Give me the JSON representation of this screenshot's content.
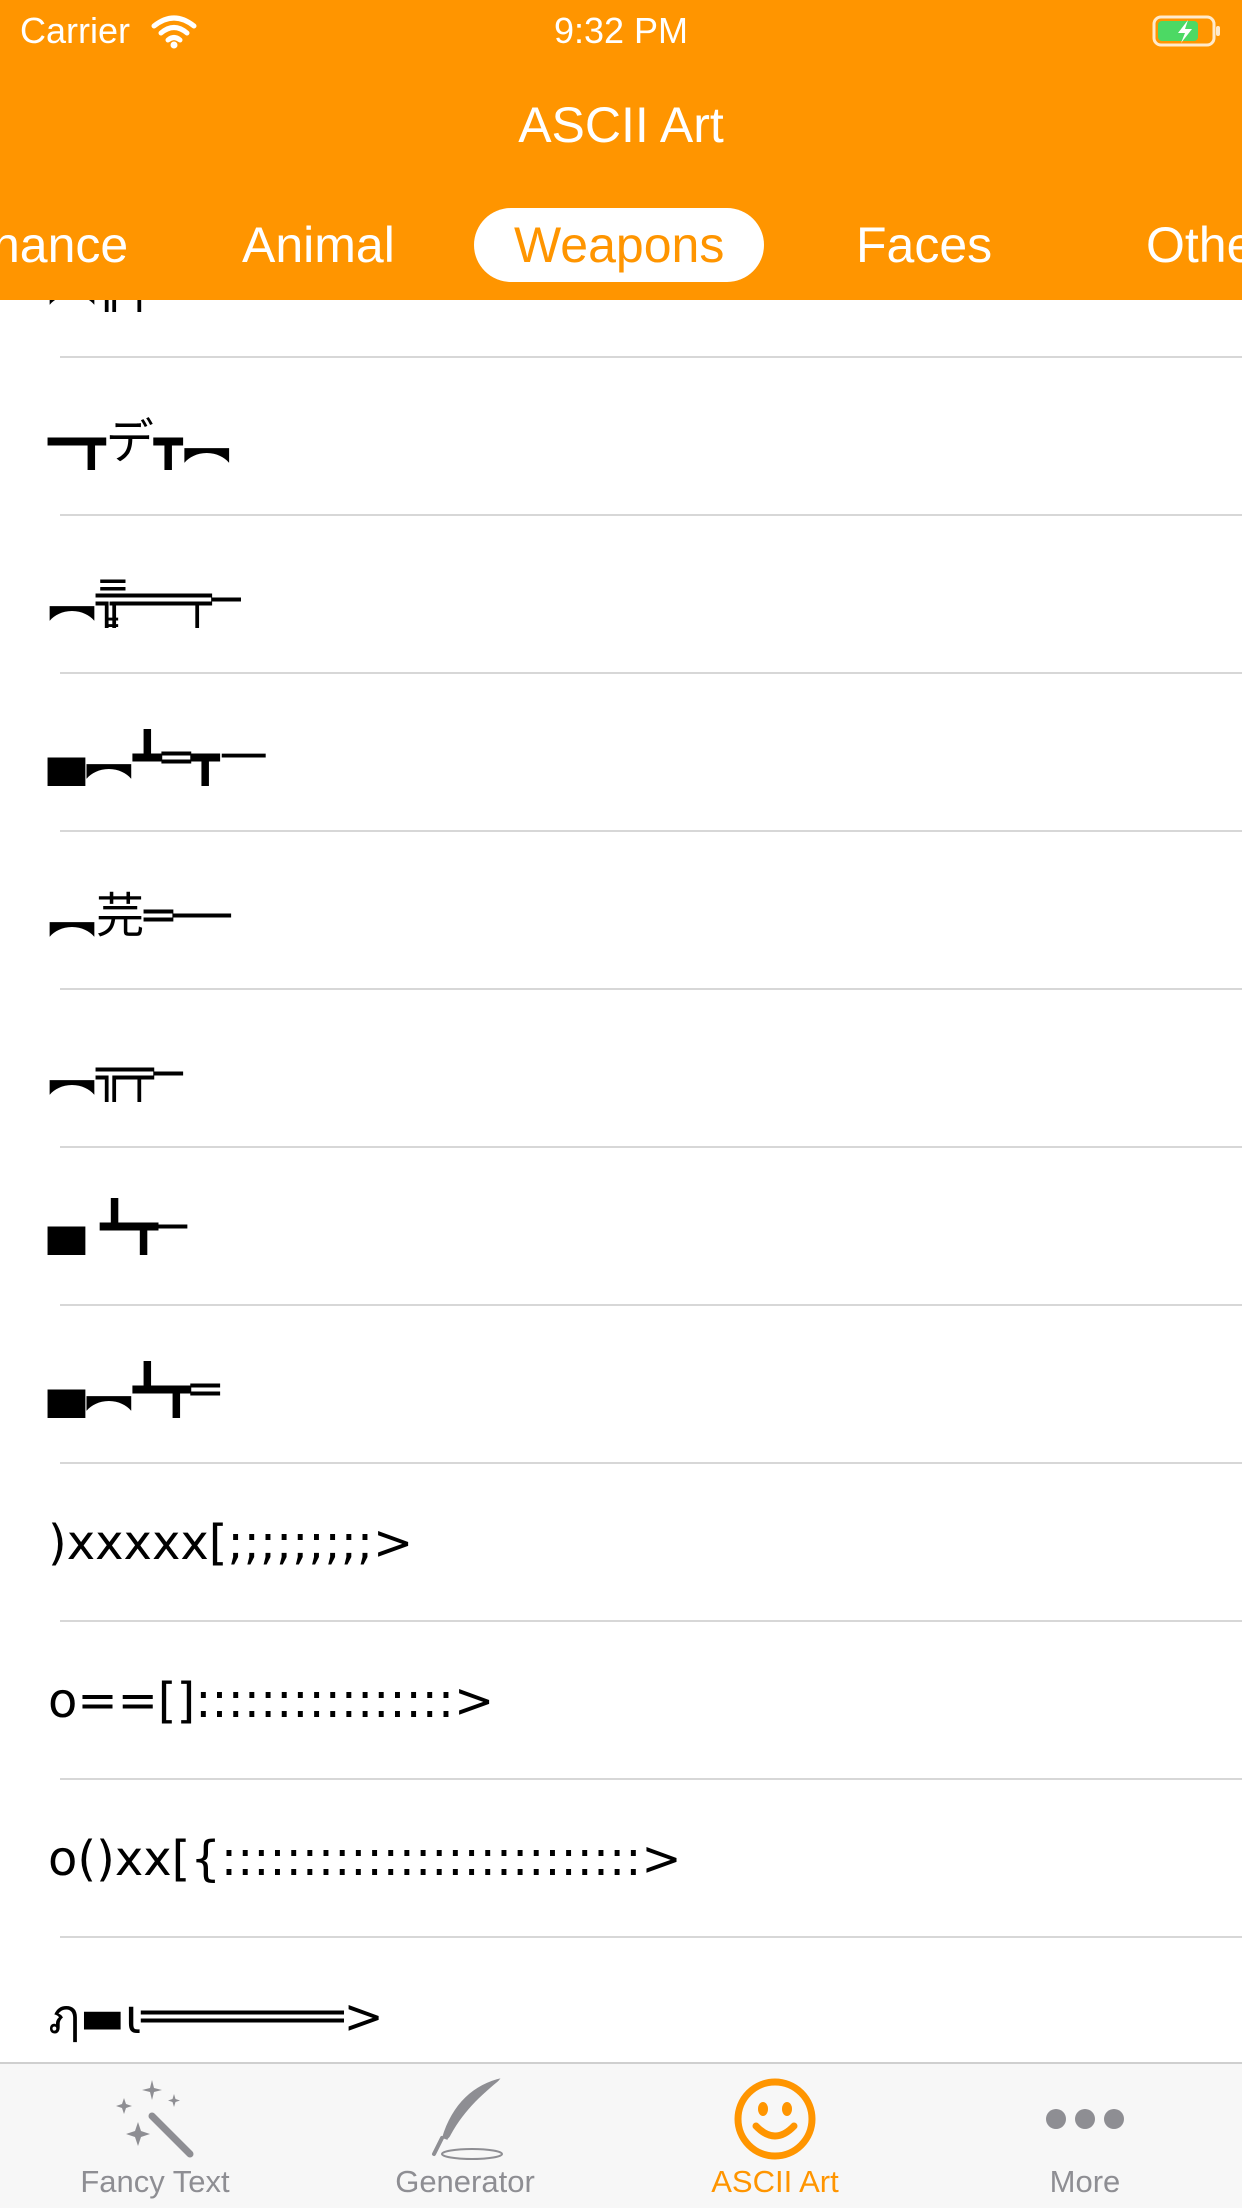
{
  "status_bar": {
    "carrier": "Carrier",
    "time": "9:32 PM",
    "wifi_icon": "wifi-icon",
    "battery_icon": "battery-charging-icon"
  },
  "header": {
    "title": "ASCII Art",
    "color": "#FF9500"
  },
  "categories": [
    {
      "label": "nance",
      "selected": false
    },
    {
      "label": "Animal",
      "selected": false
    },
    {
      "label": "Weapons",
      "selected": true
    },
    {
      "label": "Faces",
      "selected": false
    },
    {
      "label": "Othe",
      "selected": false
    }
  ],
  "items": [
    "︻╦╤─",
    "━┳デ┳︻",
    "︻╦̵̵͇̿̿̿̿══╤─",
    "▄︻┻═┳一",
    "︻芫═──",
    "︻╦╤─",
    "▄ ┻┳─",
    "▄︻┻┳═",
    ")xxxxx[;;;;;;;;;>",
    "o==[]::::::::::::::::>",
    "o()xx[{::::::::::::::::::::::::::>",
    "ฦ▬ι═══════>"
  ],
  "tab_bar": {
    "items": [
      {
        "label": "Fancy Text",
        "icon": "magic-wand-icon",
        "active": false
      },
      {
        "label": "Generator",
        "icon": "quill-icon",
        "active": false
      },
      {
        "label": "ASCII Art",
        "icon": "smiley-icon",
        "active": true
      },
      {
        "label": "More",
        "icon": "more-dots-icon",
        "active": false
      }
    ],
    "active_color": "#FF9500",
    "inactive_color": "#8e8e93"
  }
}
